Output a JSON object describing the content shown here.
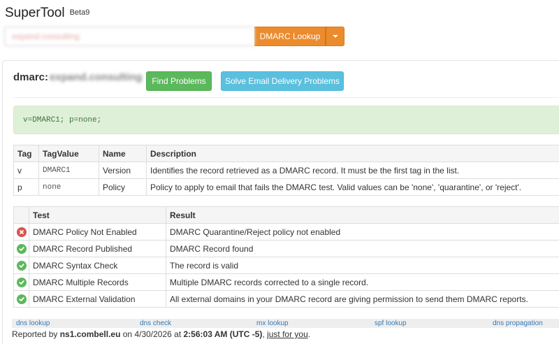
{
  "app": {
    "title": "SuperTool",
    "beta": "Beta9"
  },
  "search": {
    "value": "expand.consulting",
    "button_label": "DMARC Lookup",
    "accent": "#ec8b2c"
  },
  "result": {
    "prefix": "dmarc:",
    "domain": "expand.consulting",
    "find_problems_label": "Find Problems",
    "solve_label": "Solve Email Delivery Problems",
    "record": "v=DMARC1; p=none;"
  },
  "tag_table": {
    "headers": [
      "Tag",
      "TagValue",
      "Name",
      "Description"
    ],
    "rows": [
      [
        "v",
        "DMARC1",
        "Version",
        "Identifies the record retrieved as a DMARC record. It must be the first tag in the list."
      ],
      [
        "p",
        "none",
        "Policy",
        "Policy to apply to email that fails the DMARC test. Valid values can be 'none', 'quarantine', or 'reject'."
      ]
    ]
  },
  "test_table": {
    "headers": [
      "",
      "Test",
      "Result"
    ],
    "rows": [
      {
        "status": "error",
        "icon": "x-circle-icon",
        "test": "DMARC Policy Not Enabled",
        "result": "DMARC Quarantine/Reject policy not enabled"
      },
      {
        "status": "ok",
        "icon": "check-circle-icon",
        "test": "DMARC Record Published",
        "result": "DMARC Record found"
      },
      {
        "status": "ok",
        "icon": "check-circle-icon",
        "test": "DMARC Syntax Check",
        "result": "The record is valid"
      },
      {
        "status": "ok",
        "icon": "check-circle-icon",
        "test": "DMARC Multiple Records",
        "result": "Multiple DMARC records corrected to a single record."
      },
      {
        "status": "ok",
        "icon": "check-circle-icon",
        "test": "DMARC External Validation",
        "result": "All external domains in your DMARC record are giving permission to send them DMARC reports."
      }
    ]
  },
  "footer": {
    "links": [
      "dns lookup",
      "dns check",
      "mx lookup",
      "spf lookup",
      "dns propagation"
    ],
    "reported_prefix": "Reported by ",
    "server": "ns1.combell.eu",
    "date_prefix": " on 4/30/2026 at ",
    "time": "2:56:03 AM (UTC -5)",
    "separator": ", ",
    "just_for_you": "just for you",
    "end": "."
  },
  "colors": {
    "ok": "#5cb85c",
    "error": "#d9534f",
    "info": "#5bc0de",
    "record_bg": "#dff0d8"
  }
}
